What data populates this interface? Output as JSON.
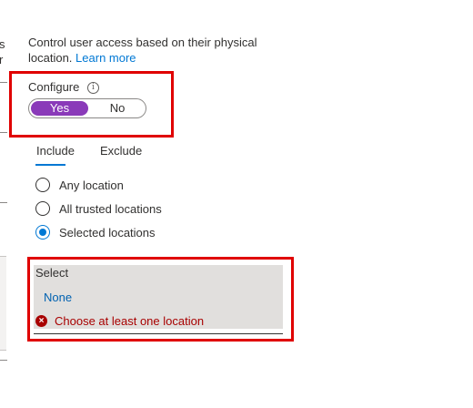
{
  "left_panel": {
    "fragments": [
      "s",
      "r"
    ]
  },
  "description": {
    "text": "Control user access based on their physical location.",
    "link": "Learn more"
  },
  "configure": {
    "label": "Configure",
    "info_glyph": "i",
    "toggle": {
      "yes": "Yes",
      "no": "No",
      "selected": "Yes"
    }
  },
  "tabs": {
    "include": "Include",
    "exclude": "Exclude",
    "active": "Include"
  },
  "radios": {
    "any": "Any location",
    "trusted": "All trusted locations",
    "selected": "Selected locations",
    "checked": "Selected locations"
  },
  "select": {
    "title": "Select",
    "value": "None",
    "error_glyph": "×",
    "error": "Choose at least one location"
  },
  "colors": {
    "accent": "#0078d4",
    "toggle_on": "#8a3ab9",
    "error": "#a80000",
    "highlight_box": "#e00000",
    "select_background": "#e1dfdd"
  }
}
